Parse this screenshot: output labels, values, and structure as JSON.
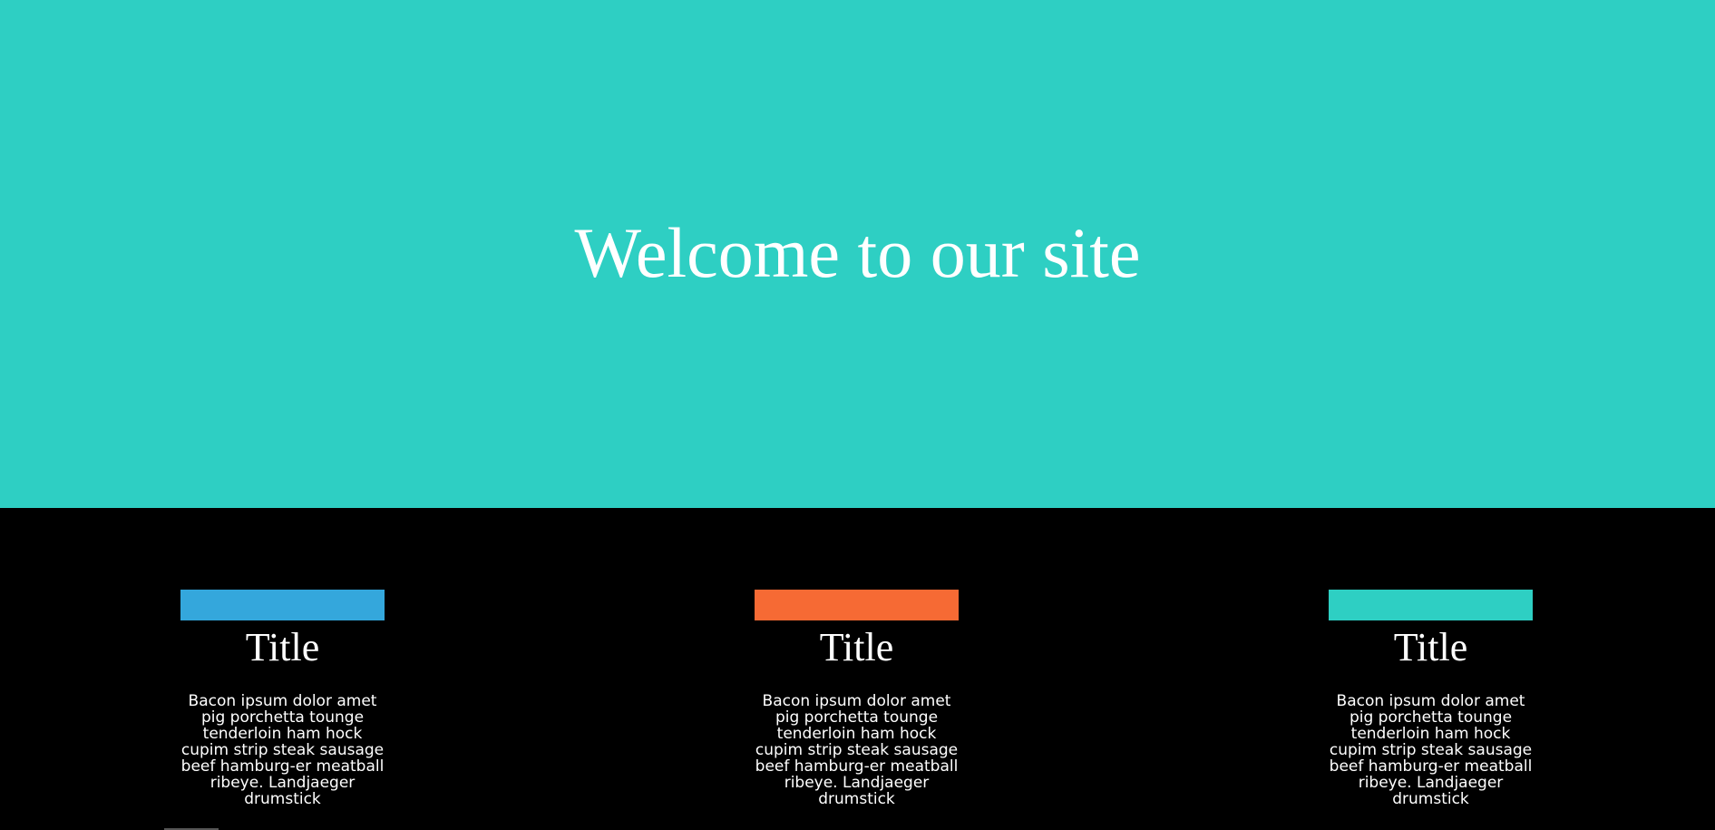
{
  "hero": {
    "title": "Welcome to our site",
    "background": "#2ecfc3"
  },
  "features": {
    "background": "#000000",
    "cards": [
      {
        "title": "Title",
        "accent": "#34a7dc",
        "text": "Bacon ipsum dolor amet pig porchetta tounge tenderloin ham hock cupim strip steak sausage beef hamburg-er meatball ribeye. Landjaeger drumstick"
      },
      {
        "title": "Title",
        "accent": "#f66a34",
        "text": "Bacon ipsum dolor amet pig porchetta tounge tenderloin ham hock cupim strip steak sausage beef hamburg-er meatball ribeye. Landjaeger drumstick"
      },
      {
        "title": "Title",
        "accent": "#2ecfc3",
        "text": "Bacon ipsum dolor amet pig porchetta tounge tenderloin ham hock cupim strip steak sausage beef hamburg-er meatball ribeye. Landjaeger drumstick"
      }
    ]
  }
}
